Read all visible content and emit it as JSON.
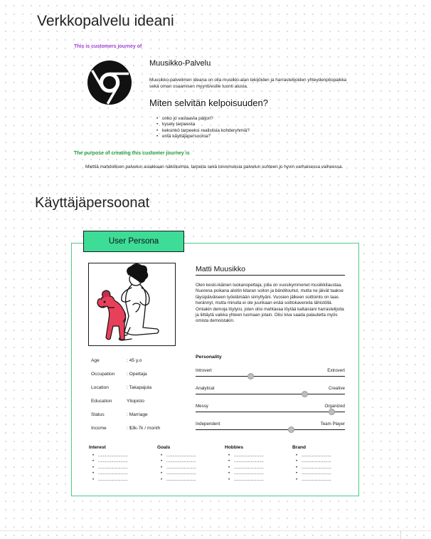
{
  "page": {
    "title": "Verkkopalvelu ideani",
    "journey_tag": "This is customers journey of",
    "service": {
      "title": "Muusikko-Palvelu",
      "description": "Muusikko-palvelimen ideana on olla musiikki-alan tekijöiden ja harrastelijoiden yhteydenpitopaikka sekä oman osaamisen myynti/esille tuonti alusta."
    },
    "question": {
      "title": "Miten selvitän kelpoisuuden?",
      "items": [
        "onko jo vastaavia paljon?",
        "kysely tarpeesta",
        "keksinkö tarpeeksi realistisia kohderyhmiä?",
        "entä käyttäjäpersoonia?"
      ]
    },
    "purpose_tag": "The purpose of creating this customer journey is",
    "purpose_text": "Miettiä mahdollisen palvelun asiakkaan näkökulmia, tarpeita sekä toivomuksia palvelun suhteen jo hyvin varhaisessa vaiheessa.",
    "personas_title": "Käyttäjäpersoonat"
  },
  "persona": {
    "tab_label": "User Persona",
    "name": "Matti Muusikko",
    "bio": "Olen keski-ikäinen luokanopettaja, jolla on vuosikymmenet musiikkitaustaa. Nuorena poikana aloitin kitaran soiton ja bänditouhut, mutta ne jäivät taakse täysipäiväiseen työelämään siirryttyäni. Vuosien jälkeen soittointo on taas herännyt, mutta minulla ei ole juurikaan enää soittokavereita lähistöllä. Omiakin demoja löytyisi, joten olisi mahtavaa löytää kaltaisiani harrastelijoita ja liittäytä vaikka yhteen luomaan jotain. Olisi kiva saada palautetta myös omista demoistakin.",
    "info": [
      {
        "label": "Age",
        "value": ": 45 y.o"
      },
      {
        "label": "Occupation",
        "value": ": Opettaja"
      },
      {
        "label": "Location",
        "value": ": Takapajula"
      },
      {
        "label": "Education",
        "value": "Yliopisto"
      },
      {
        "label": "Status",
        "value": ": Marriage"
      },
      {
        "label": "Income",
        "value": ": $3k-7k / month"
      }
    ],
    "personality_title": "Personality",
    "traits": [
      {
        "left": "Introvert",
        "right": "Extrovert",
        "level": 0.37
      },
      {
        "left": "Analytical",
        "right": "Creative",
        "level": 0.73
      },
      {
        "left": "Messy",
        "right": "Organized",
        "level": 0.91
      },
      {
        "left": "Independent",
        "right": "Team Player",
        "level": 0.64
      }
    ],
    "columns": [
      {
        "title": "Interest",
        "items": [
          ".........................",
          ".........................",
          ".........................",
          ".........................",
          "........................."
        ]
      },
      {
        "title": "Goals",
        "items": [
          ".........................",
          ".........................",
          ".........................",
          ".........................",
          "........................."
        ]
      },
      {
        "title": "Hobbies",
        "items": [
          ".........................",
          ".........................",
          ".........................",
          ".........................",
          "........................."
        ]
      },
      {
        "title": "Brand",
        "items": [
          ".........................",
          ".........................",
          ".........................",
          ".........................",
          "........................."
        ]
      }
    ]
  },
  "icons": {
    "logo": "chrome-logo-icon",
    "portrait": "persona-illustration",
    "slider_knob": "slider-knob-icon"
  },
  "colors": {
    "accent_green": "#3ddc97",
    "frame_green": "#4ec98a",
    "tag_purple": "#9b3fd6",
    "tag_green": "#1f9a3a",
    "dog_red": "#e8405a"
  }
}
